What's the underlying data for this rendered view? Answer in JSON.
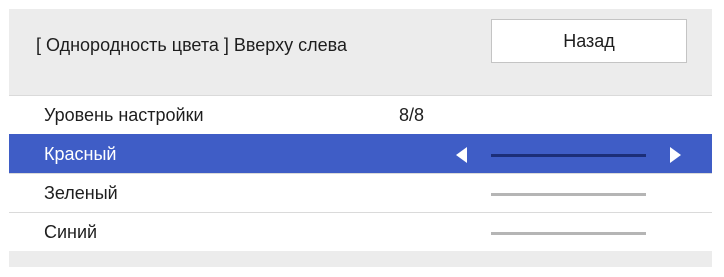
{
  "header": {
    "title": "[ Однородность цвета ] Вверху слева",
    "back_label": "Назад"
  },
  "menu": {
    "adjustment_level": {
      "label": "Уровень настройки",
      "value": "8/8"
    },
    "red": {
      "label": "Красный",
      "selected": true
    },
    "green": {
      "label": "Зеленый"
    },
    "blue": {
      "label": "Синий"
    }
  },
  "colors": {
    "selection_highlight": "#3f5dc6",
    "panel_background": "#ececec",
    "slider_track": "#b5b5b5",
    "slider_track_selected": "#1c2e78"
  },
  "icons": {
    "decrease": "left-triangle-icon",
    "increase": "right-triangle-icon"
  }
}
